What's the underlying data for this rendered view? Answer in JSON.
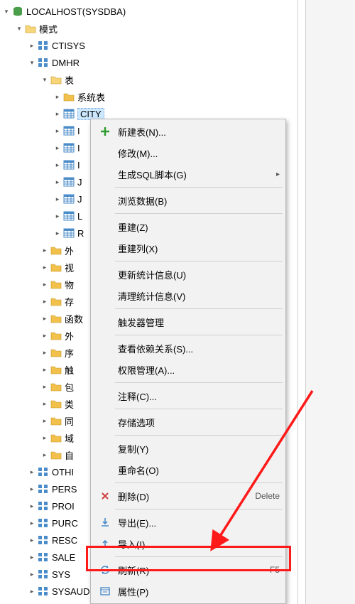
{
  "root": {
    "label": "LOCALHOST(SYSDBA)"
  },
  "schemas_root": {
    "label": "模式"
  },
  "schemas": {
    "ctisys": "CTISYS",
    "dmhr": "DMHR",
    "othi": "OTHI",
    "pers": "PERS",
    "proi": "PROI",
    "purc": "PURC",
    "resc": "RESC",
    "sale": "SALE",
    "sys": "SYS",
    "sysauditor": "SYSAUDITOR"
  },
  "tables_root": {
    "label": "表"
  },
  "system_tables": {
    "label": "系统表"
  },
  "city": {
    "label": "CITY"
  },
  "hidden_tables": [
    "I",
    "I",
    "I",
    "J",
    "J",
    "L",
    "R"
  ],
  "folders": {
    "f1": "外",
    "f2": "视",
    "f3": "物",
    "f4": "存",
    "f5": "函数",
    "f6": "外",
    "f7": "序",
    "f8": "触",
    "f9": "包",
    "f10": "类",
    "f11": "同",
    "f12": "域",
    "f13": "自"
  },
  "menu": {
    "new_table": "新建表(N)...",
    "modify": "修改(M)...",
    "gen_sql": "生成SQL脚本(G)",
    "browse": "浏览数据(B)",
    "rebuild": "重建(Z)",
    "rebuild_col": "重建列(X)",
    "update_stats": "更新统计信息(U)",
    "clear_stats": "清理统计信息(V)",
    "trigger_mgmt": "触发器管理",
    "view_deps": "查看依赖关系(S)...",
    "perm_mgmt": "权限管理(A)...",
    "comments": "注释(C)...",
    "storage_opts": "存储选项",
    "copy": "复制(Y)",
    "rename": "重命名(O)",
    "delete": "删除(D)",
    "delete_sc": "Delete",
    "export": "导出(E)...",
    "import": "导入(I)...",
    "refresh": "刷新(R)",
    "refresh_sc": "F5",
    "properties": "属性(P)"
  }
}
